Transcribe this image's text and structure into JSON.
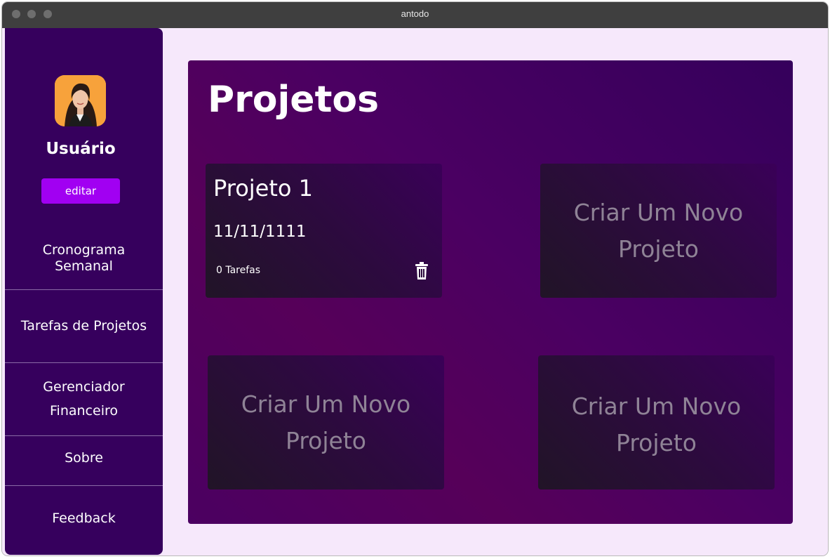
{
  "window": {
    "title": "antodo"
  },
  "sidebar": {
    "username": "Usuário",
    "edit_label": "editar",
    "items": [
      {
        "label": "Cronograma Semanal"
      },
      {
        "label": "Tarefas de Projetos"
      },
      {
        "label": "Gerenciador Financeiro"
      },
      {
        "label": "Sobre"
      },
      {
        "label": "Feedback"
      }
    ]
  },
  "main": {
    "title": "Projetos",
    "projects": [
      {
        "name": "Projeto 1",
        "date": "11/11/1111",
        "tasks": "0 Tarefas"
      }
    ],
    "new_project_label": "Criar Um Novo Projeto"
  },
  "colors": {
    "sidebar_bg": "#36005d",
    "accent_button": "#a100f2",
    "page_bg": "#f6e8fb"
  }
}
